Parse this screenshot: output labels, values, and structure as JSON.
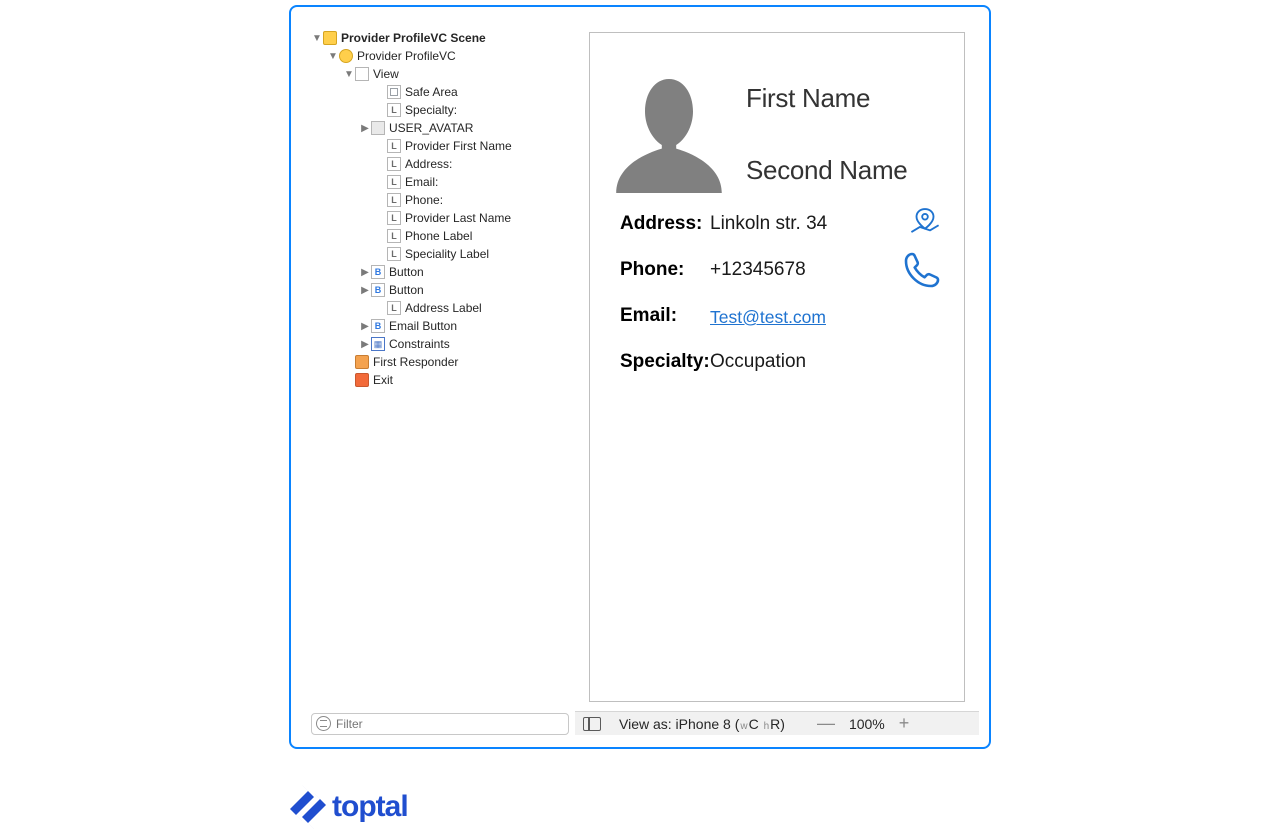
{
  "outline": {
    "scene": "Provider ProfileVC Scene",
    "vc": "Provider ProfileVC",
    "view": "View",
    "items": {
      "safe_area": "Safe Area",
      "specialty": "Specialty:",
      "user_avatar": "USER_AVATAR",
      "first_name": "Provider First Name",
      "address": "Address:",
      "email": "Email:",
      "phone": "Phone:",
      "last_name": "Provider Last Name",
      "phone_label": "Phone Label",
      "speciality_label": "Speciality Label",
      "button1": "Button",
      "button2": "Button",
      "address_label": "Address Label",
      "email_button": "Email Button",
      "constraints": "Constraints"
    },
    "first_responder": "First Responder",
    "exit": "Exit"
  },
  "filter_placeholder": "Filter",
  "canvas": {
    "first_name": "First Name",
    "second_name": "Second Name",
    "labels": {
      "address": "Address:",
      "phone": "Phone:",
      "email": "Email:",
      "specialty": "Specialty:"
    },
    "values": {
      "address": "Linkoln str. 34",
      "phone": "+12345678",
      "email": "Test@test.com",
      "specialty": "Occupation"
    }
  },
  "statusbar": {
    "view_as_prefix": "View as: iPhone 8 (",
    "w": "w",
    "c": "C ",
    "h": "h",
    "r": "R)",
    "zoom": "100%"
  },
  "brand": "toptal"
}
